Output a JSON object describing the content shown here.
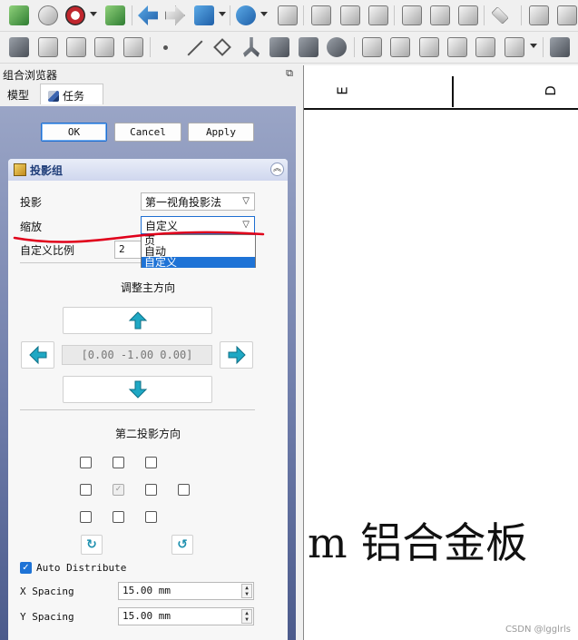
{
  "panel": {
    "title": "组合浏览器",
    "float_icon": "⧉",
    "tabs": [
      {
        "label": "模型"
      },
      {
        "label": "任务"
      }
    ]
  },
  "dialog": {
    "ok_label": "OK",
    "cancel_label": "Cancel",
    "apply_label": "Apply",
    "group_title": "投影组",
    "projection": {
      "label": "投影",
      "value": "第一视角投影法"
    },
    "scale": {
      "label": "缩放",
      "value": "自定义",
      "options": [
        "页",
        "自动",
        "自定义"
      ],
      "selected_index": 2
    },
    "custom_scale": {
      "label": "自定义比例",
      "value": "2"
    },
    "primary_direction": {
      "title": "调整主方向",
      "vector": "[0.00 -1.00 0.00]"
    },
    "secondary_direction": {
      "title": "第二投影方向"
    },
    "auto_distribute": {
      "label": "Auto Distribute",
      "checked": true
    },
    "x_spacing": {
      "label": "X Spacing",
      "value": "15.00 mm"
    },
    "y_spacing": {
      "label": "Y Spacing",
      "value": "15.00 mm"
    }
  },
  "drawing": {
    "strip_letters": [
      "E",
      "D"
    ],
    "text": "m 铝合金板"
  },
  "watermark": "CSDN @lgglrls",
  "colors": {
    "accent": "#1e73d6",
    "annotation_red": "#e0001b",
    "arrow": "#1fa8c4"
  }
}
